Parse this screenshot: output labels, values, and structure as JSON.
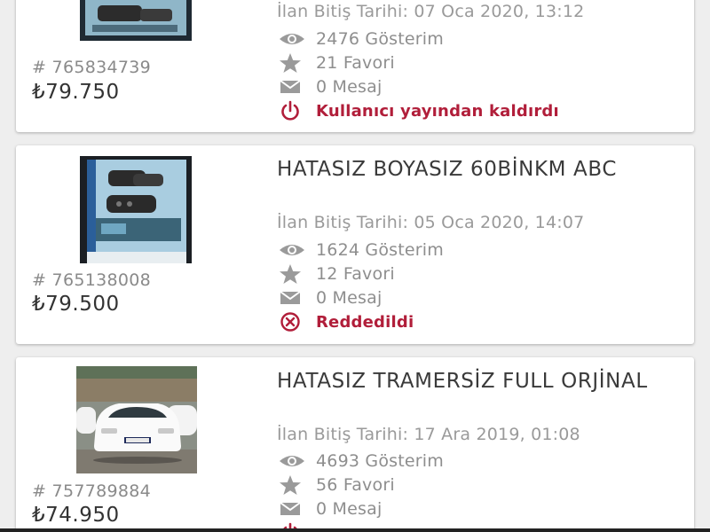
{
  "colors": {
    "background": "#eeeeee",
    "card": "#ffffff",
    "status_red": "#b11e3a",
    "muted_text": "#8e8e8e"
  },
  "listings": [
    {
      "title": "",
      "end_date": "İlan Bitiş Tarihi: 07 Oca 2020, 13:12",
      "views": "2476 Gösterim",
      "favorites": "21 Favori",
      "messages": "0 Mesaj",
      "status": "Kullanıcı yayından kaldırdı",
      "status_icon": "power-icon",
      "ad_number": "# 765834739",
      "price": "₺79.750",
      "image": "car-keys-photo"
    },
    {
      "title": "HATASIZ BOYASIZ 60BİNKM ABC",
      "end_date": "İlan Bitiş Tarihi: 05 Oca 2020, 14:07",
      "views": "1624 Gösterim",
      "favorites": "12 Favori",
      "messages": "0 Mesaj",
      "status": "Reddedildi",
      "status_icon": "circle-x-icon",
      "ad_number": "# 765138008",
      "price": "₺79.500",
      "image": "car-keys-photo"
    },
    {
      "title": "HATASIZ TRAMERSİZ FULL ORJİNAL",
      "end_date": "İlan Bitiş Tarihi: 17 Ara 2019, 01:08",
      "views": "4693 Gösterim",
      "favorites": "56 Favori",
      "messages": "0 Mesaj",
      "status": "",
      "status_icon": "power-icon",
      "ad_number": "# 757789884",
      "price": "₺74.950",
      "image": "white-car-photo"
    }
  ]
}
